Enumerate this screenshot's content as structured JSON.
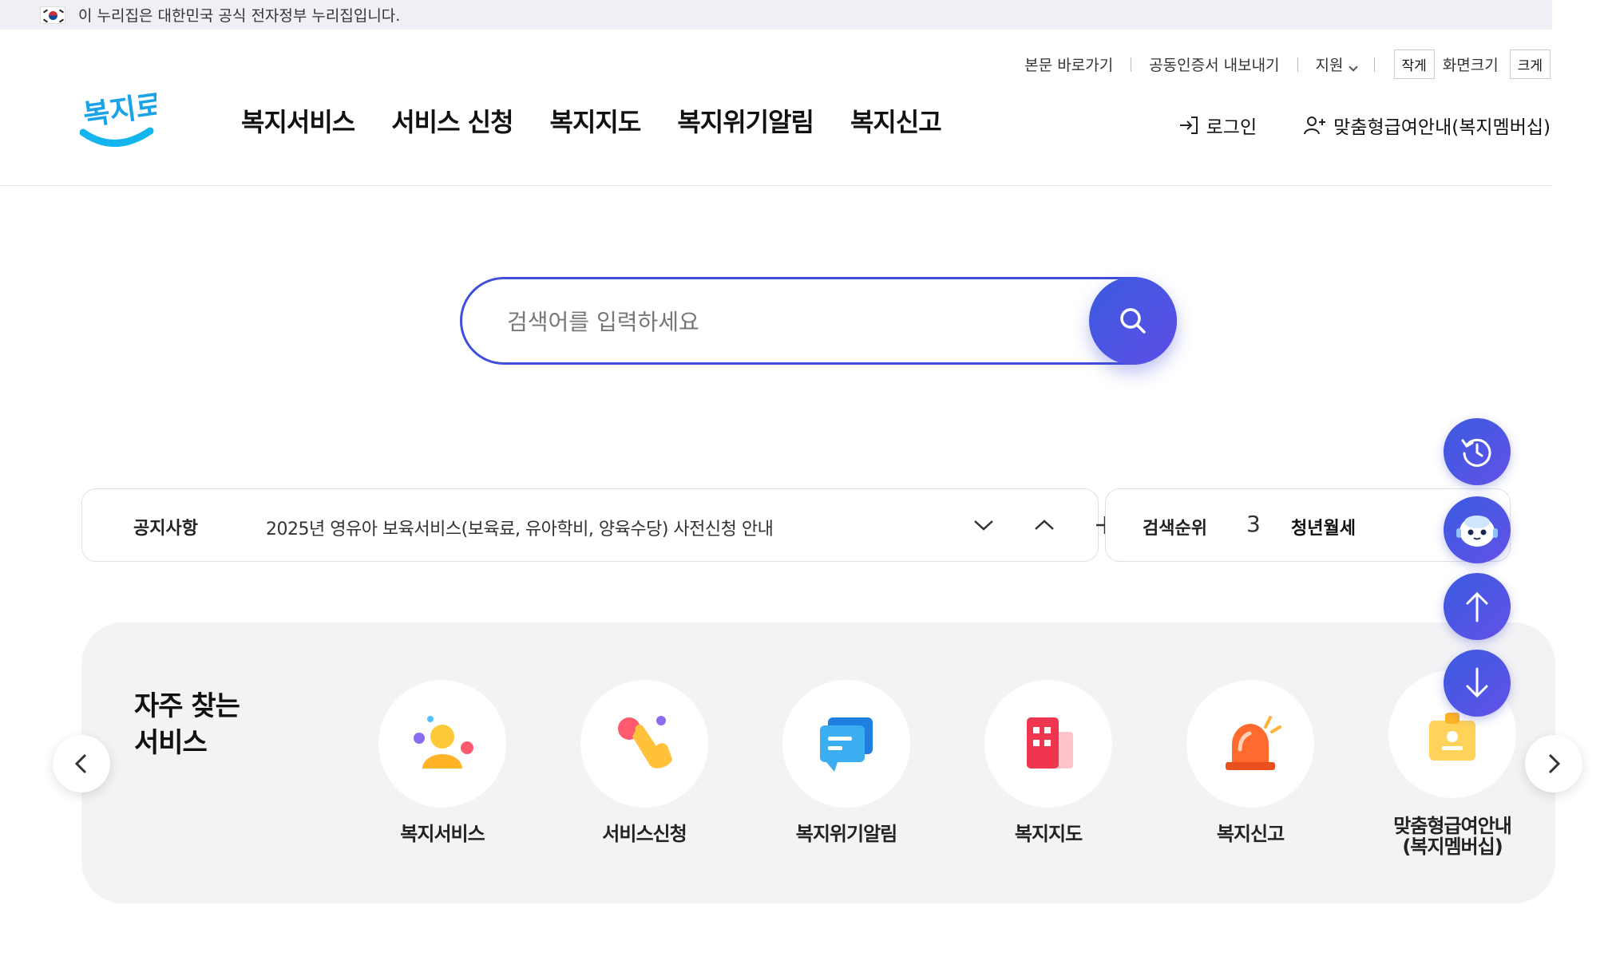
{
  "gov_banner": {
    "text": "이 누리집은 대한민국 공식 전자정부 누리집입니다."
  },
  "util_nav": {
    "skip": "본문 바로가기",
    "cert": "공동인증서 내보내기",
    "support": "지원",
    "size_small": "작게",
    "size_label": "화면크기",
    "size_large": "크게"
  },
  "logo": {
    "text": "복지로"
  },
  "gnb": [
    "복지서비스",
    "서비스 신청",
    "복지지도",
    "복지위기알림",
    "복지신고"
  ],
  "member": {
    "login": "로그인",
    "benefit": "맞춤형급여안내(복지멤버십)"
  },
  "search": {
    "placeholder": "검색어를 입력하세요"
  },
  "notice": {
    "title": "공지사항",
    "text": "2025년 영유아 보육서비스(보육료, 유아학비, 양육수당) 사전신청 안내"
  },
  "rank": {
    "title": "검색순위",
    "number": "3",
    "keyword": "청년월세"
  },
  "frequent": {
    "title_line1": "자주 찾는",
    "title_line2": "서비스",
    "items": [
      {
        "label": "복지서비스",
        "icon": "person-icon"
      },
      {
        "label": "서비스신청",
        "icon": "hand-touch-icon"
      },
      {
        "label": "복지위기알림",
        "icon": "chat-bubble-icon"
      },
      {
        "label": "복지지도",
        "icon": "map-building-icon"
      },
      {
        "label": "복지신고",
        "icon": "siren-icon"
      },
      {
        "label_line1": "맞춤형급여안내",
        "label_line2": "(복지멤버십)",
        "icon": "id-badge-icon"
      }
    ]
  },
  "floating": [
    "history-icon",
    "chatbot-icon",
    "arrow-up-icon",
    "arrow-down-icon"
  ],
  "colors": {
    "accent": "#3f4fd9",
    "accent_dark": "#5e4ee6",
    "panel_bg": "#f3f3f5"
  }
}
